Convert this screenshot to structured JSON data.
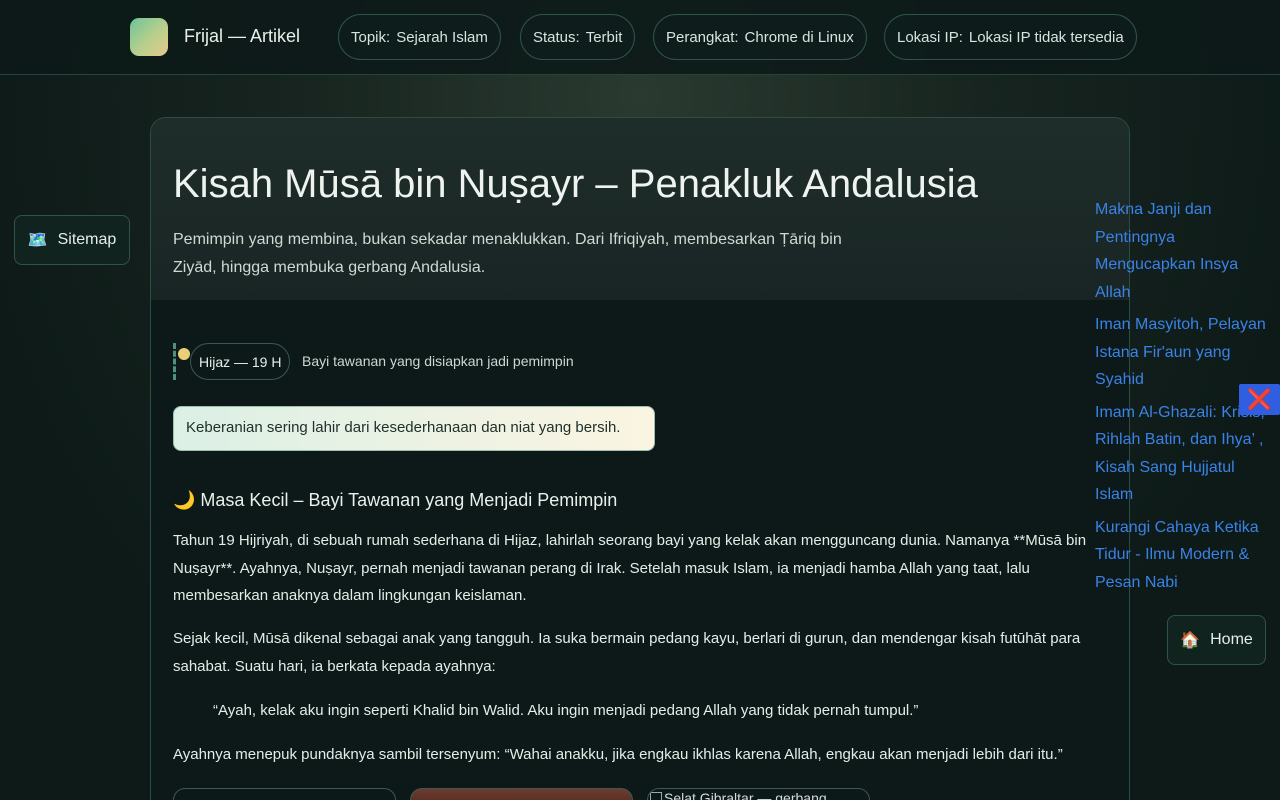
{
  "header": {
    "brand_title": "Frijal — Artikel",
    "pills": [
      {
        "key": "Topik:",
        "value": "Sejarah Islam"
      },
      {
        "key": "Status:",
        "value": "Terbit"
      },
      {
        "key": "Perangkat:",
        "value": "Chrome di Linux"
      },
      {
        "key": "Lokasi IP:",
        "value": "Lokasi IP tidak tersedia"
      }
    ]
  },
  "article": {
    "title": "Kisah Mūsā bin Nuṣayr – Penakluk Andalusia",
    "subtitle": "Pemimpin yang membina, bukan sekadar menaklukkan. Dari Ifriqiyah, membesarkan Ṭāriq bin Ziyād, hingga membuka gerbang Andalusia.",
    "timeline": {
      "badge": "Hijaz — 19 H",
      "text": "Bayi tawanan yang disiapkan jadi pemimpin"
    },
    "highlight_quote": "Keberanian sering lahir dari kesederhanaan dan niat yang bersih.",
    "section_heading": "🌙 Masa Kecil – Bayi Tawanan yang Menjadi Pemimpin",
    "paragraphs": [
      "Tahun 19 Hijriyah, di sebuah rumah sederhana di Hijaz, lahirlah seorang bayi yang kelak akan mengguncang dunia. Namanya **Mūsā bin Nuṣayr**. Ayahnya, Nuṣayr, pernah menjadi tawanan perang di Irak. Setelah masuk Islam, ia menjadi hamba Allah yang taat, lalu membesarkan anaknya dalam lingkungan keislaman.",
      "Sejak kecil, Mūsā dikenal sebagai anak yang tangguh. Ia suka bermain pedang kayu, berlari di gurun, dan mendengar kisah futūhāt para sahabat. Suatu hari, ia berkata kepada ayahnya:",
      "“Ayah, kelak aku ingin seperti Khalid bin Walid. Aku ingin menjadi pedang Allah yang tidak pernah tumpul.”",
      "Ayahnya menepuk pundaknya sambil tersenyum: “Wahai anakku, jika engkau ikhlas karena Allah, engkau akan menjadi lebih dari itu.”"
    ],
    "images": [
      {
        "alt": ""
      },
      {
        "alt": ""
      },
      {
        "alt": "Selat Gibraltar — gerbang"
      }
    ]
  },
  "side": {
    "sitemap_label": "Sitemap",
    "sitemap_icon": "🗺️",
    "home_label": "Home",
    "home_icon": "🏠",
    "close_icon": "❌",
    "related_links": [
      "Makna Janji dan Pentingnya Mengucapkan Insya Allah",
      "Iman Masyitoh, Pelayan Istana Fir'aun yang Syahid",
      "Imam Al-Ghazali: Krisis, Rihlah Batin, dan Ihya’ , Kisah Sang Hujjatul Islam",
      "Kurangi Cahaya Ketika Tidur - Ilmu Modern & Pesan Nabi"
    ]
  },
  "colors": {
    "accent_link": "#3b82e6",
    "timeline_dot": "#e9cf78",
    "close_button_bg": "#2f5fe0"
  }
}
